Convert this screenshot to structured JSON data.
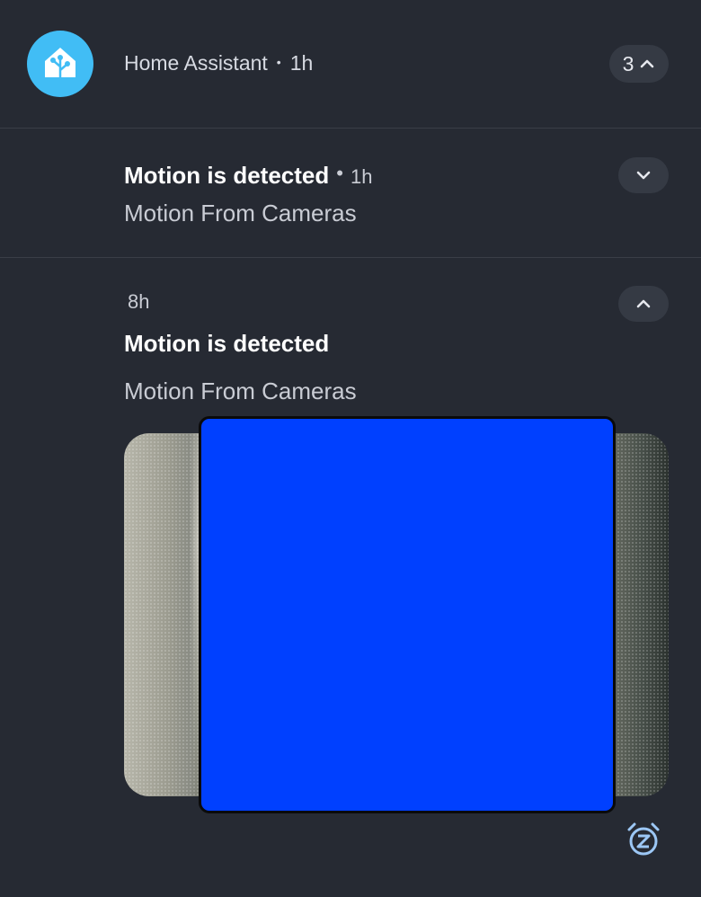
{
  "header": {
    "app_name": "Home Assistant",
    "separator": "•",
    "time": "1h",
    "count": "3",
    "app_icon": "home-assistant-icon"
  },
  "notifications": [
    {
      "title": "Motion is detected",
      "time": "1h",
      "body": "Motion From Cameras",
      "expand_icon": "chevron-down-icon"
    },
    {
      "time": "8h",
      "title": "Motion is detected",
      "body": "Motion From Cameras",
      "collapse_icon": "chevron-up-icon",
      "image": "camera-snapshot",
      "snooze_icon": "snooze-alarm-icon"
    }
  ],
  "colors": {
    "background": "#262a33",
    "pill": "#353a44",
    "accent": "#41bdf5",
    "redaction": "#0040ff",
    "snooze": "#9cc7f5"
  }
}
